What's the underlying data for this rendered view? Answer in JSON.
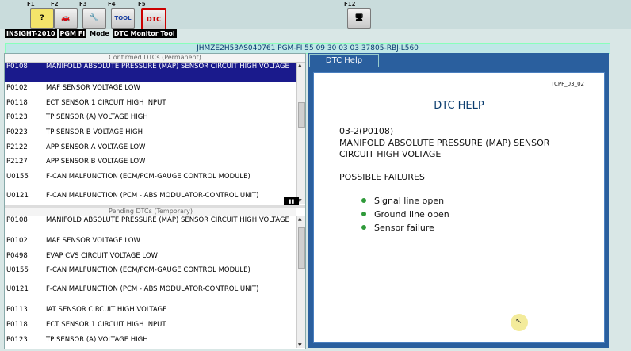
{
  "toolbar": {
    "keys": [
      {
        "label": "F1",
        "icon": "help-icon",
        "glyph": "?"
      },
      {
        "label": "F2",
        "icon": "car-icon",
        "glyph": "🚗"
      },
      {
        "label": "F3",
        "icon": "tools-icon",
        "glyph": "🔧"
      },
      {
        "label": "F4",
        "icon": "tool-icon",
        "glyph": "TOOL"
      },
      {
        "label": "F5",
        "icon": "dtc-icon",
        "glyph": "DTC"
      },
      {
        "label": "F12",
        "icon": "computer-icon",
        "glyph": "🖥"
      }
    ]
  },
  "modebar": {
    "vehicle": "INSIGHT-2010",
    "system": "PGM FI",
    "mode_label": "Mode",
    "mode": "DTC Monitor Tool"
  },
  "vinbar": {
    "text": "JHMZE2H53AS040761  PGM-FI  55 09 30 03 03  37805-RBJ-L560"
  },
  "confirmed": {
    "header": "Confirmed DTCs (Permanent)",
    "rows": [
      {
        "code": "P0108",
        "desc": "MANIFOLD ABSOLUTE PRESSURE (MAP) SENSOR CIRCUIT HIGH VOLTAGE"
      },
      {
        "code": "P0102",
        "desc": "MAF SENSOR VOLTAGE LOW"
      },
      {
        "code": "P0118",
        "desc": "ECT SENSOR 1 CIRCUIT HIGH INPUT"
      },
      {
        "code": "P0123",
        "desc": "TP SENSOR (A) VOLTAGE HIGH"
      },
      {
        "code": "P0223",
        "desc": "TP SENSOR B VOLTAGE HIGH"
      },
      {
        "code": "P2122",
        "desc": "APP SENSOR A VOLTAGE LOW"
      },
      {
        "code": "P2127",
        "desc": "APP SENSOR B VOLTAGE LOW"
      },
      {
        "code": "U0155",
        "desc": "F-CAN MALFUNCTION (ECM/PCM-GAUGE CONTROL MODULE)"
      },
      {
        "code": "U0121",
        "desc": "F-CAN MALFUNCTION (PCM - ABS MODULATOR-CONTROL UNIT)"
      }
    ]
  },
  "pending": {
    "header": "Pending DTCs (Temporary)",
    "rows": [
      {
        "code": "P0108",
        "desc": "MANIFOLD ABSOLUTE PRESSURE (MAP) SENSOR CIRCUIT HIGH VOLTAGE"
      },
      {
        "code": "P0102",
        "desc": "MAF SENSOR VOLTAGE LOW"
      },
      {
        "code": "P0498",
        "desc": "EVAP CVS CIRCUIT VOLTAGE LOW"
      },
      {
        "code": "U0155",
        "desc": "F-CAN MALFUNCTION (ECM/PCM-GAUGE CONTROL MODULE)"
      },
      {
        "code": "U0121",
        "desc": "F-CAN MALFUNCTION (PCM - ABS MODULATOR-CONTROL UNIT)"
      },
      {
        "code": "P0113",
        "desc": "IAT SENSOR CIRCUIT HIGH VOLTAGE"
      },
      {
        "code": "P0118",
        "desc": "ECT SENSOR 1 CIRCUIT HIGH INPUT"
      },
      {
        "code": "P0123",
        "desc": "TP SENSOR (A) VOLTAGE HIGH"
      }
    ]
  },
  "help": {
    "tab_label": "DTC Help",
    "doc_id": "TCPF_03_02",
    "title": "DTC HELP",
    "code_line": "03-2(P0108)",
    "desc_line1": "MANIFOLD ABSOLUTE PRESSURE (MAP) SENSOR",
    "desc_line2": "CIRCUIT HIGH VOLTAGE",
    "failures_header": "POSSIBLE FAILURES",
    "failures": [
      "Signal line open",
      "Ground line open",
      "Sensor failure"
    ]
  },
  "colors": {
    "selection": "#1a1a8c",
    "accent": "#2a5f9e",
    "bullet": "#2f9a3a"
  }
}
